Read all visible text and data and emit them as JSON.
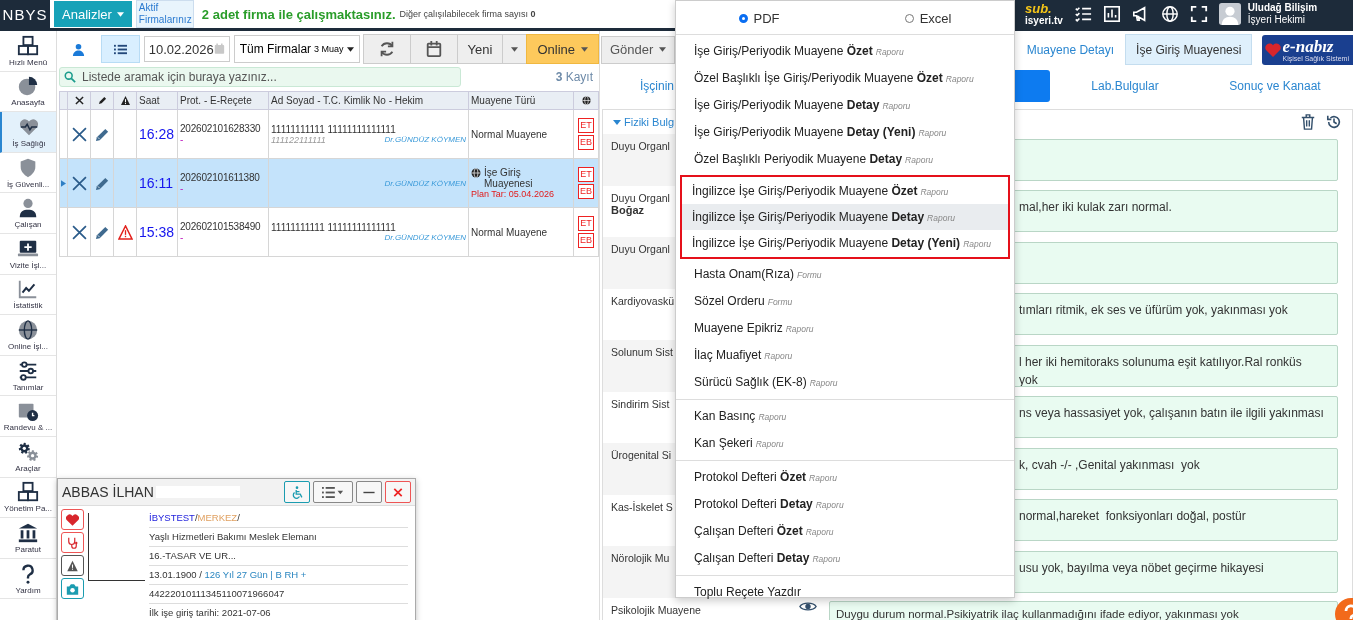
{
  "topbar": {
    "logo": "NBYS",
    "analyses_button": "Analizler",
    "active_firms": "Aktif Firmalarınız",
    "firm_message": "**2** adet firma ile çalışmaktasınız.",
    "other_firms": "Diğer çalışılabilecek firma sayısı **0**",
    "brand_prefix": "sub.",
    "brand": "isyeri.tv",
    "user_name": "Uludağ Bilişim",
    "user_role": "İşyeri Hekimi"
  },
  "sidebar": {
    "items": [
      {
        "label": "Hızlı Menü",
        "selected": false
      },
      {
        "label": "Anasayfa",
        "selected": false
      },
      {
        "label": "İş Sağlığı",
        "selected": true
      },
      {
        "label": "İş Güvenli...",
        "selected": false
      },
      {
        "label": "Çalışan",
        "selected": false
      },
      {
        "label": "Vizite İşl...",
        "selected": false
      },
      {
        "label": "İstatistik",
        "selected": false
      },
      {
        "label": "Online İşl...",
        "selected": false
      },
      {
        "label": "Tanımlar",
        "selected": false
      },
      {
        "label": "Randevu & ...",
        "selected": false
      },
      {
        "label": "Araçlar",
        "selected": false
      },
      {
        "label": "Yönetim Pa...",
        "selected": false
      },
      {
        "label": "Paratut",
        "selected": false
      },
      {
        "label": "Yardım",
        "selected": false
      }
    ]
  },
  "list_panel": {
    "view_tabs": [
      {
        "kind": "person",
        "selected": false
      },
      {
        "kind": "list",
        "selected": true
      }
    ],
    "date": "10.02.2026",
    "firm_filter": "Tüm Firmalar",
    "firm_filter_note": "3 Muay",
    "new_button": "Yeni",
    "online_button": "Online",
    "search": {
      "placeholder": "Listede aramak için buraya yazınız..."
    },
    "record_count": "**3** Kayıt",
    "table": {
      "columns": [
        "Saat",
        "Prot. - E-Reçete",
        "Ad Soyad - T.C. Kimlik No - Hekim",
        "Muayene Türü"
      ],
      "rows": [
        {
          "selected": false,
          "warning": false,
          "online": false,
          "time": "16:28",
          "protocol": "202602101628330",
          "erecete": "-",
          "name": "11111111111 11111111111111",
          "tc": "111122111111",
          "doctor": "Dr.GÜNDÜZ KÖYMEN",
          "type": "Normal Muayene",
          "badges": [
            "ET",
            "EB"
          ]
        },
        {
          "selected": true,
          "warning": false,
          "online": true,
          "time": "16:11",
          "protocol": "202602101611380",
          "erecete": "-",
          "doctor": "Dr.GÜNDÜZ KÖYMEN",
          "type": "İşe Giriş Muayenesi",
          "plan": "Plan Tar: 05.04.2026",
          "badges": [
            "ET",
            "EB"
          ]
        },
        {
          "selected": false,
          "warning": true,
          "online": false,
          "time": "15:38",
          "protocol": "202602101538490",
          "erecete": "-",
          "name": "11111111111 11111111111111",
          "doctor": "Dr.GÜNDÜZ KÖYMEN",
          "type": "Normal Muayene",
          "badges": [
            "ET",
            "EB"
          ]
        }
      ]
    }
  },
  "detail_panel": {
    "send_button": "Gönder",
    "tabs": [
      {
        "label": "Muayene Detayı",
        "selected": false
      },
      {
        "label": "İşe Giriş Muayenesi",
        "selected": true
      }
    ],
    "enabiz": {
      "name": "e-nabız",
      "subtitle": "Kişisel Sağlık Sistemi"
    },
    "subtabs": [
      {
        "label": "İşçinin",
        "selected": false
      },
      {
        "selected": true
      },
      {
        "label": "Lab.Bulgular",
        "selected": false
      },
      {
        "label": "Sonuç ve Kanaat",
        "selected": false
      }
    ],
    "section": {
      "title": "Fiziki Bulg",
      "expanded": true
    },
    "findings": [
      {
        "label": "Duyu Organl"
      },
      {
        "label": "Duyu Organl",
        "sublabel": "Boğaz",
        "value": "mal,her iki kulak zarı normal."
      },
      {
        "label": "Duyu Organl"
      },
      {
        "label": "Kardiyovaskü",
        "value": "tımları ritmik, ek ses ve üfürüm yok, yakınması yok"
      },
      {
        "label": "Solunum Sist",
        "value": "l her iki hemitoraks solunuma eşit katılıyor.Ral ronküs\nyok"
      },
      {
        "label": "Sindirim Sist",
        "value": "ns veya hassasiyet yok, çalışanın batın ile ilgili yakınması"
      },
      {
        "label": "Ürogenital Si",
        "value": "k, cvah -/- ,Genital yakınması  yok"
      },
      {
        "label": "Kas-İskelet S",
        "value": "normal,hareket  fonksiyonları doğal, postür"
      },
      {
        "label": "Nörolojik Mu",
        "value": "usu yok, bayılma veya nöbet geçirme hikayesi"
      },
      {
        "label": "Psikolojik Muayene",
        "value": "Duygu durum normal.Psikiyatrik ilaç kullanmadığını ifade ediyor, yakınması yok",
        "eye": true
      }
    ]
  },
  "export_menu": {
    "formats": [
      {
        "label": "PDF",
        "selected": true
      },
      {
        "label": "Excel",
        "selected": false
      }
    ],
    "sections": [
      {
        "blocks": [
          {
            "outlined": false,
            "items": [
              {
                "text": "İşe Giriş/Periyodik Muayene **Özet**",
                "suffix": "Raporu",
                "selected": false
              },
              {
                "text": "Özel Başlıklı İşe Giriş/Periyodik Muayene **Özet**",
                "suffix": "Raporu",
                "selected": false
              },
              {
                "text": "İşe Giriş/Periyodik Muayene **Detay**",
                "suffix": "Raporu",
                "selected": false
              },
              {
                "text": "İşe Giriş/Periyodik Muayene **Detay (Yeni)**",
                "suffix": "Raporu",
                "selected": false
              },
              {
                "text": "Özel Başlıklı Periyodik Muayene **Detay**",
                "suffix": "Raporu",
                "selected": false
              }
            ]
          },
          {
            "outlined": true,
            "items": [
              {
                "text": "İngilizce İşe Giriş/Periyodik Muayene **Özet**",
                "suffix": "Raporu",
                "selected": false
              },
              {
                "text": "İngilizce İşe Giriş/Periyodik Muayene **Detay**",
                "suffix": "Raporu",
                "selected": true
              },
              {
                "text": "İngilizce İşe Giriş/Periyodik Muayene **Detay (Yeni)**",
                "suffix": "Raporu",
                "selected": false
              }
            ]
          },
          {
            "outlined": false,
            "items": [
              {
                "text": "Hasta Onam(Rıza)",
                "suffix": "Formu",
                "selected": false
              },
              {
                "text": "Sözel Orderu",
                "suffix": "Formu",
                "selected": false
              },
              {
                "text": "Muayene Epikriz",
                "suffix": "Raporu",
                "selected": false
              },
              {
                "text": "İlaç Muafiyet",
                "suffix": "Raporu",
                "selected": false
              },
              {
                "text": "Sürücü Sağlık (EK-8)",
                "suffix": "Raporu",
                "selected": false
              }
            ]
          }
        ]
      },
      {
        "blocks": [
          {
            "outlined": false,
            "items": [
              {
                "text": "Kan Basınç",
                "suffix": "Raporu",
                "selected": false
              },
              {
                "text": "Kan Şekeri",
                "suffix": "Raporu",
                "selected": false
              }
            ]
          }
        ]
      },
      {
        "blocks": [
          {
            "outlined": false,
            "items": [
              {
                "text": "Protokol Defteri **Özet**",
                "suffix": "Raporu",
                "selected": false
              },
              {
                "text": "Protokol Defteri **Detay**",
                "suffix": "Raporu",
                "selected": false
              },
              {
                "text": "Çalışan Defteri **Özet**",
                "suffix": "Raporu",
                "selected": false
              },
              {
                "text": "Çalışan Defteri **Detay**",
                "suffix": "Raporu",
                "selected": false
              }
            ]
          }
        ]
      },
      {
        "blocks": [
          {
            "outlined": false,
            "items": [
              {
                "text": "Toplu Reçete Yazdır",
                "selected": false
              }
            ]
          }
        ]
      }
    ]
  },
  "patient_window": {
    "name": "ABBAS İLHAN",
    "org": [
      {
        "kind": "company",
        "text": "İBYSTEST"
      },
      {
        "kind": "separator",
        "text": "/"
      },
      {
        "kind": "branch",
        "text": "MERKEZ"
      },
      {
        "kind": "separator",
        "text": "/"
      }
    ],
    "lines": [
      "Yaşlı Hizmetleri Bakımı Meslek Elemanı",
      "16.-TASAR VE UR..."
    ],
    "birth_date": "13.01.1900 /",
    "age_blood": "126 Yıl 27 Gün | B RH +",
    "id_number": "44222010111345110071966047",
    "first_entry": "İlk işe giriş tarihi: 2021-07-06"
  }
}
